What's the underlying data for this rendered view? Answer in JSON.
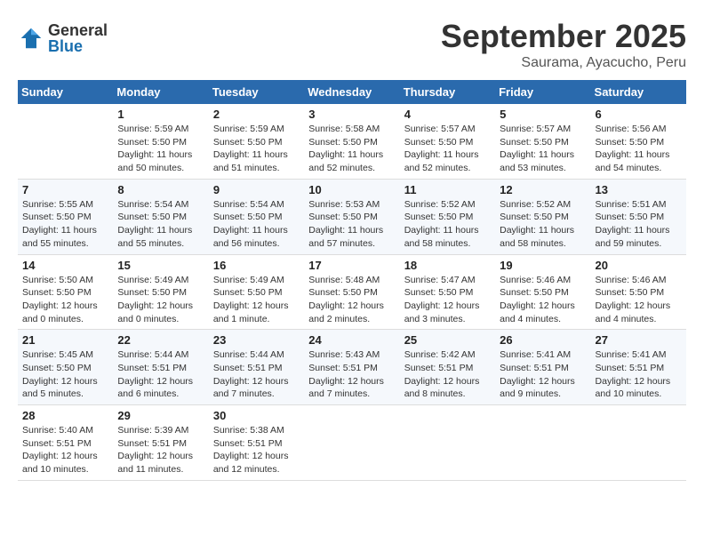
{
  "header": {
    "logo_general": "General",
    "logo_blue": "Blue",
    "month_title": "September 2025",
    "location": "Saurama, Ayacucho, Peru"
  },
  "weekdays": [
    "Sunday",
    "Monday",
    "Tuesday",
    "Wednesday",
    "Thursday",
    "Friday",
    "Saturday"
  ],
  "weeks": [
    [
      {
        "day": "",
        "info": ""
      },
      {
        "day": "1",
        "info": "Sunrise: 5:59 AM\nSunset: 5:50 PM\nDaylight: 11 hours\nand 50 minutes."
      },
      {
        "day": "2",
        "info": "Sunrise: 5:59 AM\nSunset: 5:50 PM\nDaylight: 11 hours\nand 51 minutes."
      },
      {
        "day": "3",
        "info": "Sunrise: 5:58 AM\nSunset: 5:50 PM\nDaylight: 11 hours\nand 52 minutes."
      },
      {
        "day": "4",
        "info": "Sunrise: 5:57 AM\nSunset: 5:50 PM\nDaylight: 11 hours\nand 52 minutes."
      },
      {
        "day": "5",
        "info": "Sunrise: 5:57 AM\nSunset: 5:50 PM\nDaylight: 11 hours\nand 53 minutes."
      },
      {
        "day": "6",
        "info": "Sunrise: 5:56 AM\nSunset: 5:50 PM\nDaylight: 11 hours\nand 54 minutes."
      }
    ],
    [
      {
        "day": "7",
        "info": "Sunrise: 5:55 AM\nSunset: 5:50 PM\nDaylight: 11 hours\nand 55 minutes."
      },
      {
        "day": "8",
        "info": "Sunrise: 5:54 AM\nSunset: 5:50 PM\nDaylight: 11 hours\nand 55 minutes."
      },
      {
        "day": "9",
        "info": "Sunrise: 5:54 AM\nSunset: 5:50 PM\nDaylight: 11 hours\nand 56 minutes."
      },
      {
        "day": "10",
        "info": "Sunrise: 5:53 AM\nSunset: 5:50 PM\nDaylight: 11 hours\nand 57 minutes."
      },
      {
        "day": "11",
        "info": "Sunrise: 5:52 AM\nSunset: 5:50 PM\nDaylight: 11 hours\nand 58 minutes."
      },
      {
        "day": "12",
        "info": "Sunrise: 5:52 AM\nSunset: 5:50 PM\nDaylight: 11 hours\nand 58 minutes."
      },
      {
        "day": "13",
        "info": "Sunrise: 5:51 AM\nSunset: 5:50 PM\nDaylight: 11 hours\nand 59 minutes."
      }
    ],
    [
      {
        "day": "14",
        "info": "Sunrise: 5:50 AM\nSunset: 5:50 PM\nDaylight: 12 hours\nand 0 minutes."
      },
      {
        "day": "15",
        "info": "Sunrise: 5:49 AM\nSunset: 5:50 PM\nDaylight: 12 hours\nand 0 minutes."
      },
      {
        "day": "16",
        "info": "Sunrise: 5:49 AM\nSunset: 5:50 PM\nDaylight: 12 hours\nand 1 minute."
      },
      {
        "day": "17",
        "info": "Sunrise: 5:48 AM\nSunset: 5:50 PM\nDaylight: 12 hours\nand 2 minutes."
      },
      {
        "day": "18",
        "info": "Sunrise: 5:47 AM\nSunset: 5:50 PM\nDaylight: 12 hours\nand 3 minutes."
      },
      {
        "day": "19",
        "info": "Sunrise: 5:46 AM\nSunset: 5:50 PM\nDaylight: 12 hours\nand 4 minutes."
      },
      {
        "day": "20",
        "info": "Sunrise: 5:46 AM\nSunset: 5:50 PM\nDaylight: 12 hours\nand 4 minutes."
      }
    ],
    [
      {
        "day": "21",
        "info": "Sunrise: 5:45 AM\nSunset: 5:50 PM\nDaylight: 12 hours\nand 5 minutes."
      },
      {
        "day": "22",
        "info": "Sunrise: 5:44 AM\nSunset: 5:51 PM\nDaylight: 12 hours\nand 6 minutes."
      },
      {
        "day": "23",
        "info": "Sunrise: 5:44 AM\nSunset: 5:51 PM\nDaylight: 12 hours\nand 7 minutes."
      },
      {
        "day": "24",
        "info": "Sunrise: 5:43 AM\nSunset: 5:51 PM\nDaylight: 12 hours\nand 7 minutes."
      },
      {
        "day": "25",
        "info": "Sunrise: 5:42 AM\nSunset: 5:51 PM\nDaylight: 12 hours\nand 8 minutes."
      },
      {
        "day": "26",
        "info": "Sunrise: 5:41 AM\nSunset: 5:51 PM\nDaylight: 12 hours\nand 9 minutes."
      },
      {
        "day": "27",
        "info": "Sunrise: 5:41 AM\nSunset: 5:51 PM\nDaylight: 12 hours\nand 10 minutes."
      }
    ],
    [
      {
        "day": "28",
        "info": "Sunrise: 5:40 AM\nSunset: 5:51 PM\nDaylight: 12 hours\nand 10 minutes."
      },
      {
        "day": "29",
        "info": "Sunrise: 5:39 AM\nSunset: 5:51 PM\nDaylight: 12 hours\nand 11 minutes."
      },
      {
        "day": "30",
        "info": "Sunrise: 5:38 AM\nSunset: 5:51 PM\nDaylight: 12 hours\nand 12 minutes."
      },
      {
        "day": "",
        "info": ""
      },
      {
        "day": "",
        "info": ""
      },
      {
        "day": "",
        "info": ""
      },
      {
        "day": "",
        "info": ""
      }
    ]
  ]
}
